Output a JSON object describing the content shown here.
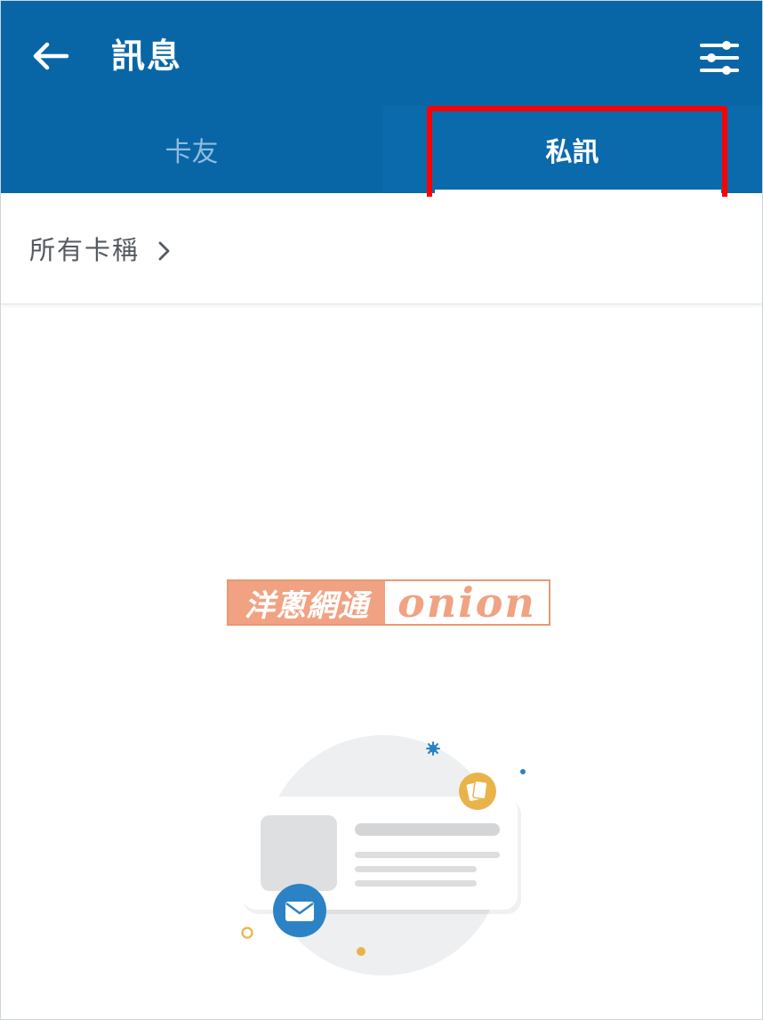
{
  "header": {
    "title": "訊息",
    "back_icon": "arrow-left-icon",
    "filter_icon": "sliders-icon"
  },
  "tabs": [
    {
      "label": "卡友",
      "selected": false
    },
    {
      "label": "私訊",
      "selected": true
    }
  ],
  "category_filter": {
    "label": "所有卡稱",
    "icon": "chevron-right-icon"
  },
  "watermark": {
    "chinese": "洋蔥網通",
    "english": "onion"
  },
  "empty_state": {
    "illustration": "message-card-illustration"
  },
  "colors": {
    "primary": "#0966a6",
    "highlight": "#ff0000",
    "envelope_badge": "#2b83c6",
    "cards_badge": "#e8b44a",
    "watermark": "#f0a282"
  }
}
